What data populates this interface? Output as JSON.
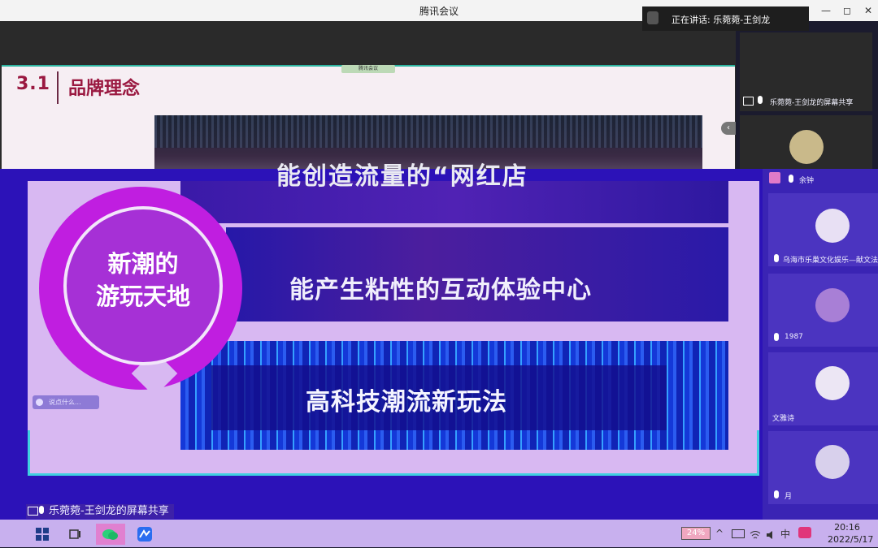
{
  "window": {
    "title": "腾讯会议",
    "controls": [
      "—",
      "◻",
      "✕"
    ]
  },
  "speaking": {
    "label": "正在讲话: 乐菀菀-王剑龙"
  },
  "slide": {
    "section_number": "3.1",
    "section_name": "品牌理念",
    "tag": "腾讯会议",
    "circle_text": "新潮的\n游玩天地",
    "lines": [
      "能创造流量的“网红店",
      "能产生粘性的互动体验中心",
      "高科技潮流新玩法"
    ],
    "chat_placeholder": "说点什么..."
  },
  "share_label": "乐菀菀-王剑龙的屏幕共享",
  "participants": [
    {
      "name": "乐菀菀-王剑龙的屏幕共享",
      "avatar_color": "#f2f2f2",
      "muted": false
    },
    {
      "name": "",
      "avatar_color": "#c9b98a",
      "muted": false
    },
    {
      "name": "余钟",
      "avatar_color": "#e07ac8",
      "muted": false
    },
    {
      "name": "乌海市乐巢文化娱乐—献文法",
      "avatar_color": "#e8e0f4",
      "muted": true
    },
    {
      "name": "1987",
      "avatar_color": "#a87fd6",
      "muted": true
    },
    {
      "name": "文雅诗",
      "avatar_color": "#ece6f4",
      "muted": false
    },
    {
      "name": "月",
      "avatar_color": "#d8d0ec",
      "muted": true
    }
  ],
  "taskbar": {
    "battery": "24%",
    "time": "20:16",
    "date": "2022/5/17",
    "ime": "中",
    "icons": [
      "windows-start-icon",
      "task-view-icon",
      "wechat-icon",
      "tencent-meeting-icon"
    ]
  },
  "colors": {
    "accent_teal": "#2bb5a0",
    "title_red": "#9a1840",
    "glitch_blue": "#2c12b8",
    "ring_magenta": "#c01ee0"
  }
}
